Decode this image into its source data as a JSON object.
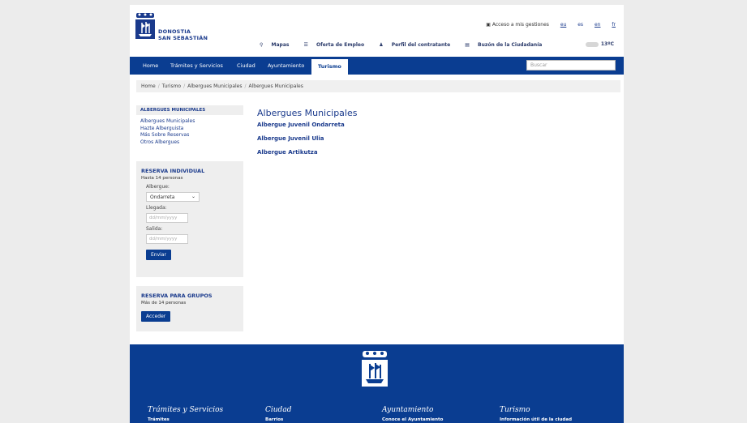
{
  "header": {
    "city_line1": "DONOSTIA",
    "city_line2": "SAN SEBASTIÁN",
    "access_label": "Acceso a mis gestiones",
    "languages": [
      "eu",
      "es",
      "en",
      "fr"
    ],
    "util_links": [
      "Mapas",
      "Oferta de Empleo",
      "Perfil del contratante",
      "Buzón de la Ciudadanía"
    ],
    "temperature": "13ºC"
  },
  "nav": {
    "items": [
      "Home",
      "Trámites y Servicios",
      "Ciudad",
      "Ayuntamiento",
      "Turismo"
    ],
    "active": "Turismo",
    "search_placeholder": "Buscar"
  },
  "breadcrumb": [
    "Home",
    "Turismo",
    "Albergues Municipales",
    "Albergues Municipales"
  ],
  "sidebar": {
    "title": "ALBERGUES MUNICIPALES",
    "links": [
      "Albergues Municipales",
      "Hazte Alberguista",
      "Más Sobre Reservas",
      "Otros Albergues"
    ]
  },
  "reserva_individual": {
    "title": "RESERVA INDIVIDUAL",
    "subtitle": "Hasta 14 personas",
    "albergue_label": "Albergue:",
    "albergue_value": "Ondarreta",
    "llegada_label": "Llegada:",
    "llegada_placeholder": "dd/mm/yyyy",
    "salida_label": "Salida:",
    "salida_placeholder": "dd/mm/yyyy",
    "button": "Enviar"
  },
  "reserva_grupos": {
    "title": "RESERVA PARA GRUPOS",
    "subtitle": "Más de 14 personas",
    "button": "Acceder"
  },
  "main": {
    "title": "Albergues Municipales",
    "albergues": [
      "Albergue Juvenil Ondarreta",
      "Albergue Juvenil Ulia",
      "Albergue Artikutza"
    ]
  },
  "footer": {
    "columns": [
      {
        "title": "Trámites y Servicios",
        "link": "Trámites"
      },
      {
        "title": "Ciudad",
        "link": "Barrios"
      },
      {
        "title": "Ayuntamiento",
        "link": "Conoce el Ayuntamiento"
      },
      {
        "title": "Turismo",
        "link": "Información útil de la ciudad"
      }
    ]
  },
  "colors": {
    "brand_blue": "#0a3d91",
    "link_blue": "#1a3a8c"
  }
}
